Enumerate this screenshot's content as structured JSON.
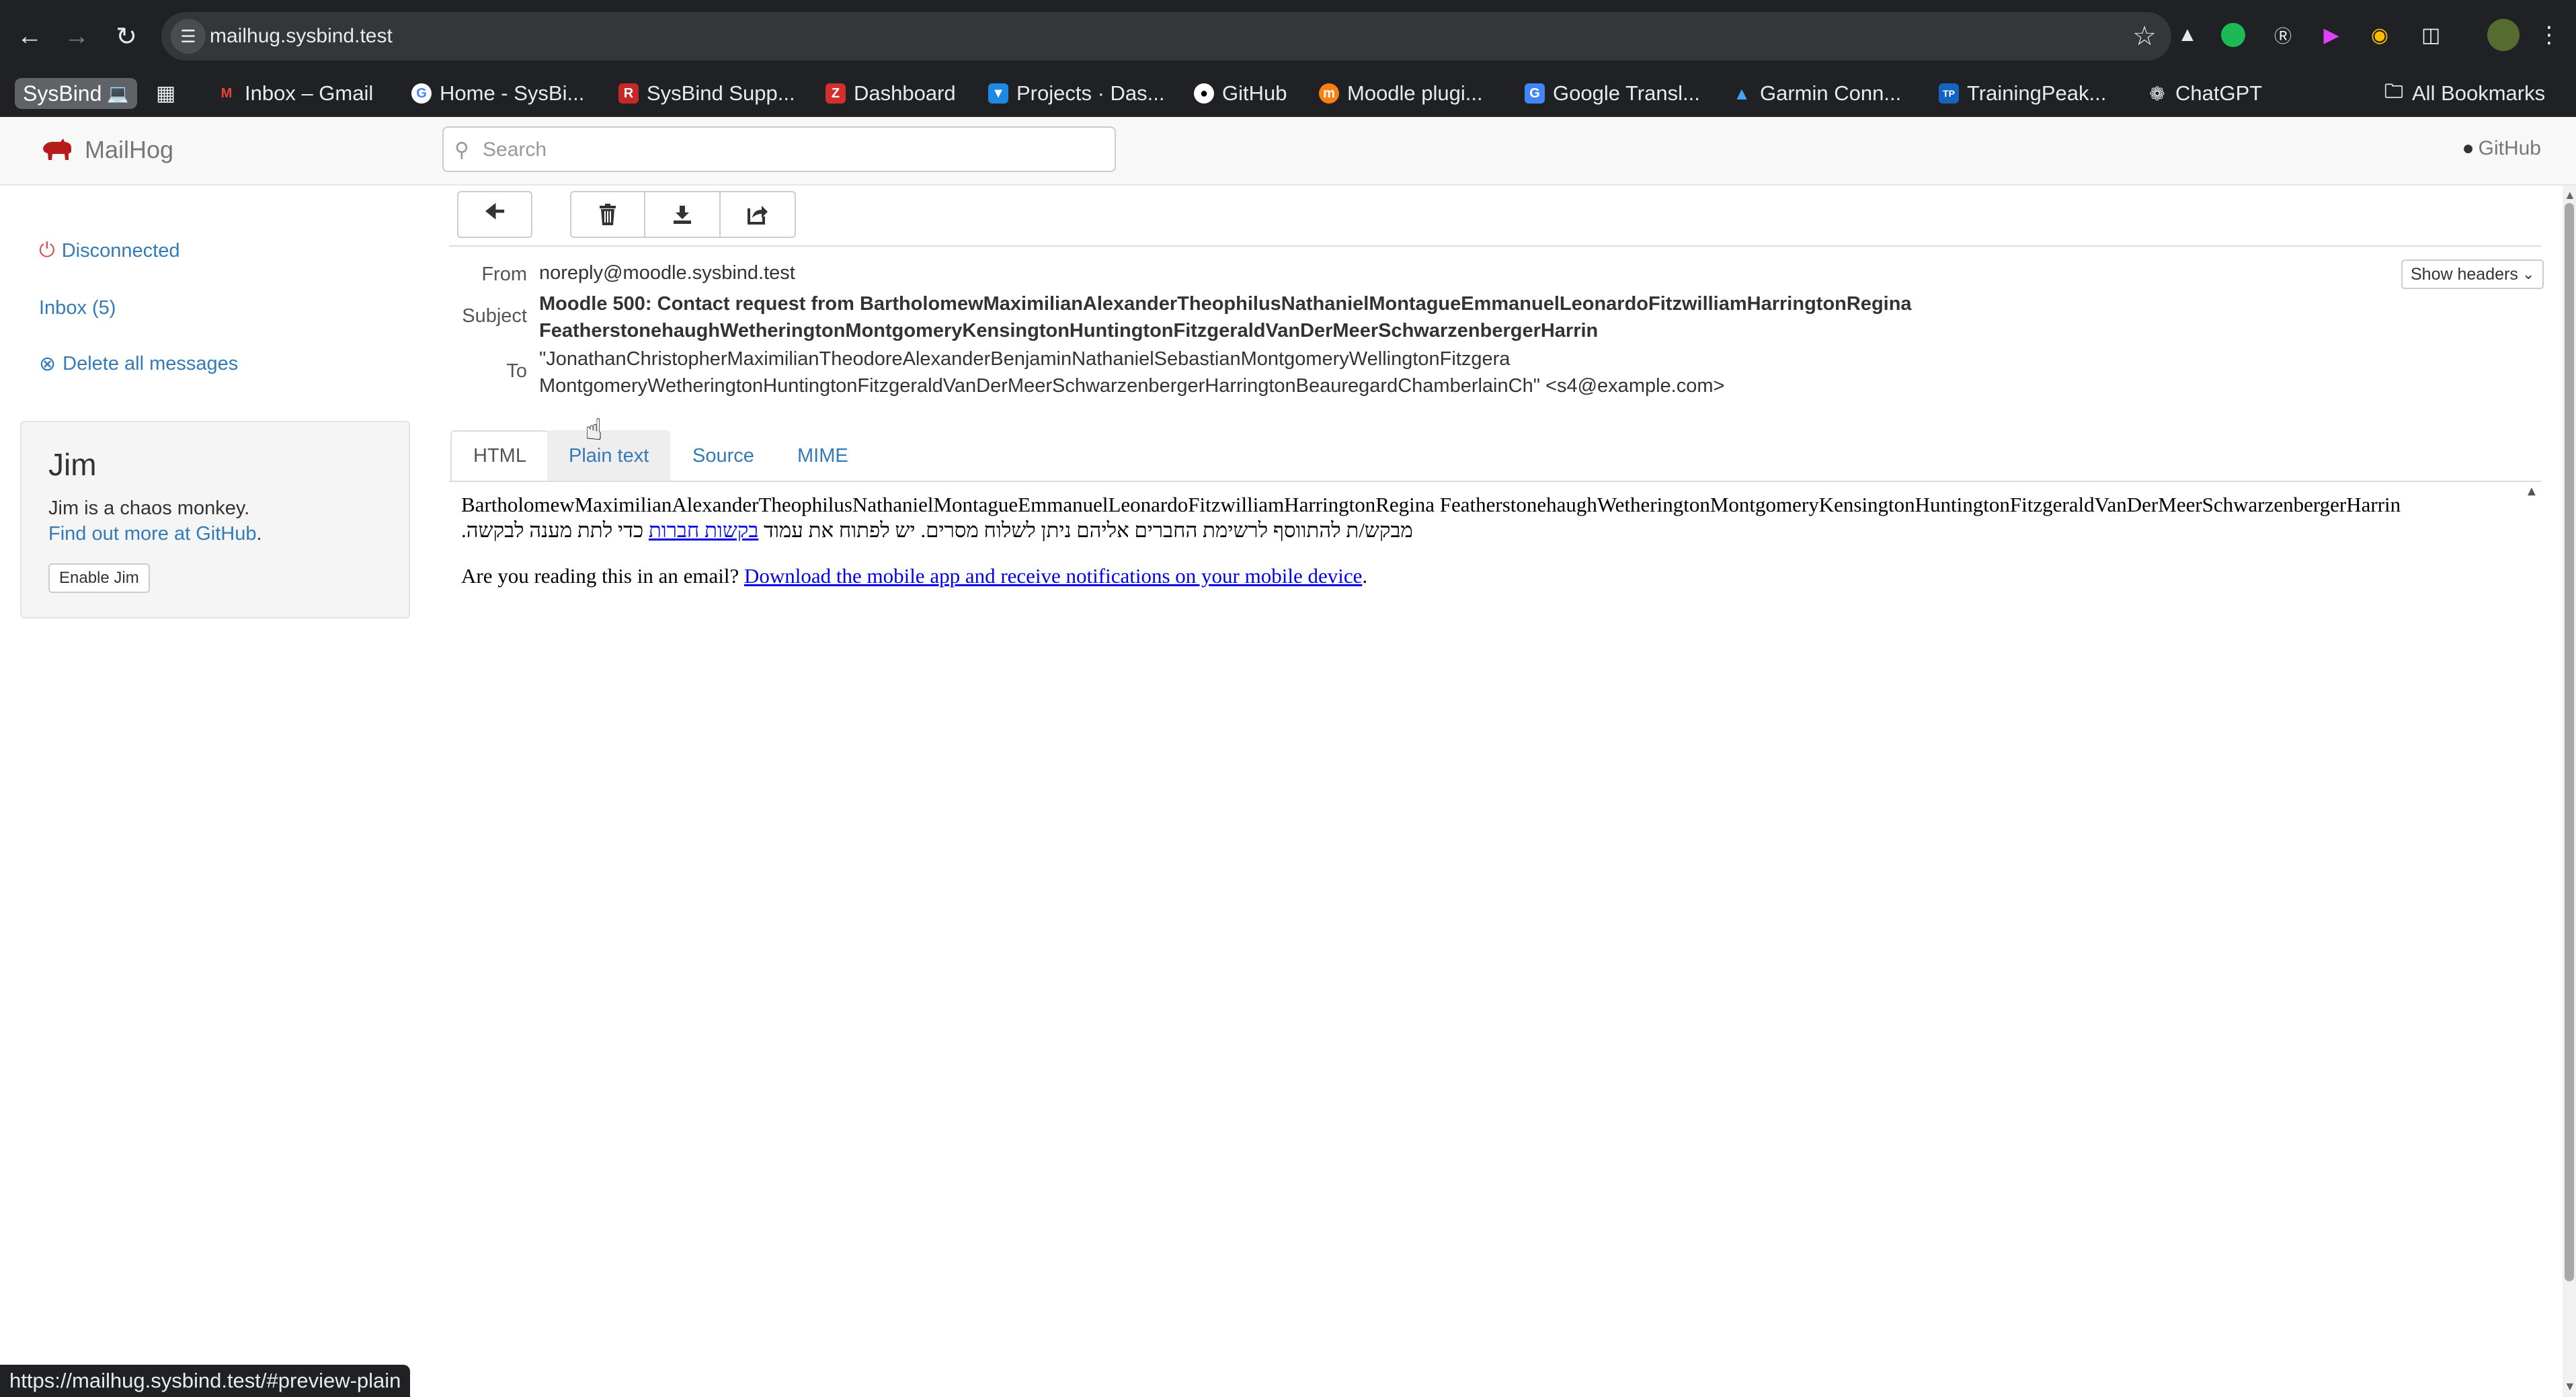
{
  "browser": {
    "url": "mailhug.sysbind.test",
    "status_url": "https://mailhug.sysbind.test/#preview-plain",
    "bookmarks": [
      {
        "label": "SysBind",
        "icon": "laptop-icon"
      },
      {
        "label": "Inbox – Gmail",
        "icon": "gmail-icon",
        "color": "#ea4335"
      },
      {
        "label": "Home - SysBi...",
        "icon": "google-icon",
        "color": "#4285f4"
      },
      {
        "label": "SysBind Supp...",
        "icon": "redmine-icon",
        "color": "#c62828"
      },
      {
        "label": "Dashboard",
        "icon": "zendesk-icon",
        "color": "#d32f2f"
      },
      {
        "label": "Projects · Das...",
        "icon": "gitlab-icon",
        "color": "#1e88e5"
      },
      {
        "label": "GitHub",
        "icon": "github-icon"
      },
      {
        "label": "Moodle plugi...",
        "icon": "moodle-icon",
        "color": "#f98012"
      },
      {
        "label": "Google Transl...",
        "icon": "translate-icon",
        "color": "#4285f4"
      },
      {
        "label": "Garmin Conn...",
        "icon": "garmin-icon",
        "color": "#1e88e5"
      },
      {
        "label": "TrainingPeak...",
        "icon": "trainingpeaks-icon",
        "color": "#1565c0"
      },
      {
        "label": "ChatGPT",
        "icon": "chatgpt-icon"
      },
      {
        "label": "All Bookmarks",
        "icon": "folder-icon"
      }
    ]
  },
  "mailhog": {
    "brand": "MailHog",
    "search_placeholder": "Search",
    "github_label": "GitHub",
    "sidebar": {
      "status": "Disconnected",
      "inbox": "Inbox (5)",
      "delete_all": "Delete all messages"
    },
    "jim": {
      "title": "Jim",
      "description": "Jim is a chaos monkey.",
      "more_link": "Find out more at GitHub",
      "more_suffix": ".",
      "button": "Enable Jim"
    },
    "message": {
      "labels": {
        "from": "From",
        "subject": "Subject",
        "to": "To"
      },
      "from": "noreply@moodle.sysbind.test",
      "subject_line1": "Moodle 500: Contact request from BartholomewMaximilianAlexanderTheophilusNathanielMontagueEmmanuelLeonardoFitzwilliamHarringtonRegina",
      "subject_line2": "FeatherstonehaughWetheringtonMontgomeryKensingtonHuntingtonFitzgeraldVanDerMeerSchwarzenbergerHarrin",
      "to_line1": "\"JonathanChristopherMaximilianTheodoreAlexanderBenjaminNathanielSebastianMontgomeryWellingtonFitzgera",
      "to_line2": "MontgomeryWetheringtonHuntingtonFitzgeraldVanDerMeerSchwarzenbergerHarringtonBeauregardChamberlainCh\" <s4@example.com>",
      "show_headers": "Show headers"
    },
    "tabs": [
      {
        "label": "HTML",
        "active": true
      },
      {
        "label": "Plain text",
        "active": false
      },
      {
        "label": "Source",
        "active": false
      },
      {
        "label": "MIME",
        "active": false
      }
    ],
    "body": {
      "line1_name": "BartholomewMaximilianAlexanderTheophilusNathanielMontagueEmmanuelLeonardoFitzwilliamHarringtonRegina FeatherstonehaughWetheringtonMontgomeryKensingtonHuntingtonFitzgeraldVanDerMeerSchwarzenbergerHarrin",
      "hebrew_pre": "מבקש/ת להתווסף לרשימת החברים אליהם ניתן לשלוח מסרים. יש לפתוח את עמוד",
      "hebrew_link": "בקשות חברות",
      "hebrew_post": "כדי לתת מענה לבקשה.",
      "app_prompt": "Are you reading this in an email?",
      "app_link": "Download the mobile app and receive notifications on your mobile device",
      "app_suffix": "."
    }
  }
}
